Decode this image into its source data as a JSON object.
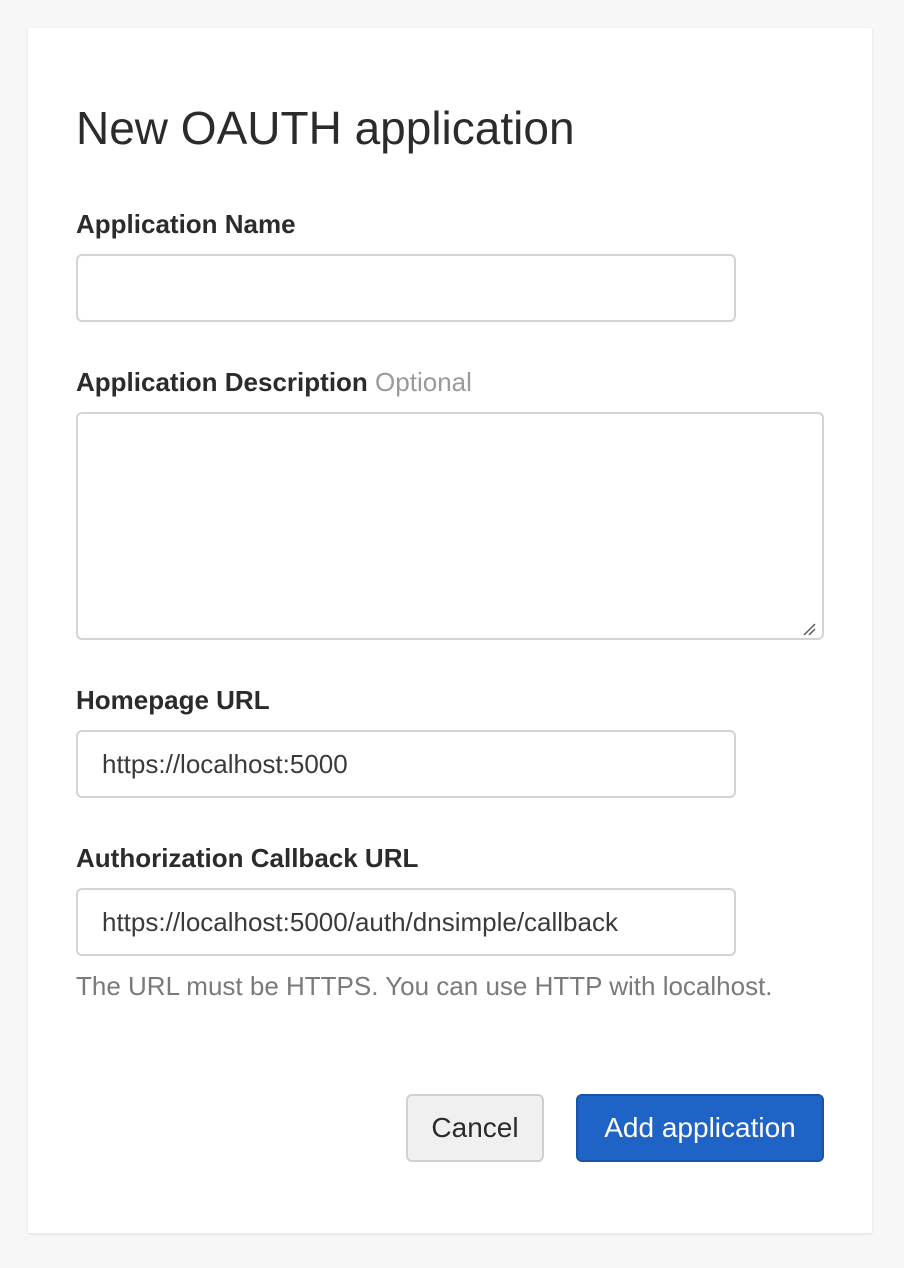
{
  "page": {
    "title": "New OAUTH application"
  },
  "form": {
    "name": {
      "label": "Application Name",
      "value": ""
    },
    "description": {
      "label": "Application Description",
      "optional_label": "Optional",
      "value": ""
    },
    "homepage": {
      "label": "Homepage URL",
      "value": "https://localhost:5000"
    },
    "callback": {
      "label": "Authorization Callback URL",
      "value": "https://localhost:5000/auth/dnsimple/callback",
      "help": "The URL must be HTTPS. You can use HTTP with localhost."
    }
  },
  "actions": {
    "cancel_label": "Cancel",
    "submit_label": "Add application"
  },
  "colors": {
    "primary": "#1f63c6",
    "background": "#f7f7f7",
    "card": "#ffffff",
    "muted_text": "#7a7a7a"
  }
}
